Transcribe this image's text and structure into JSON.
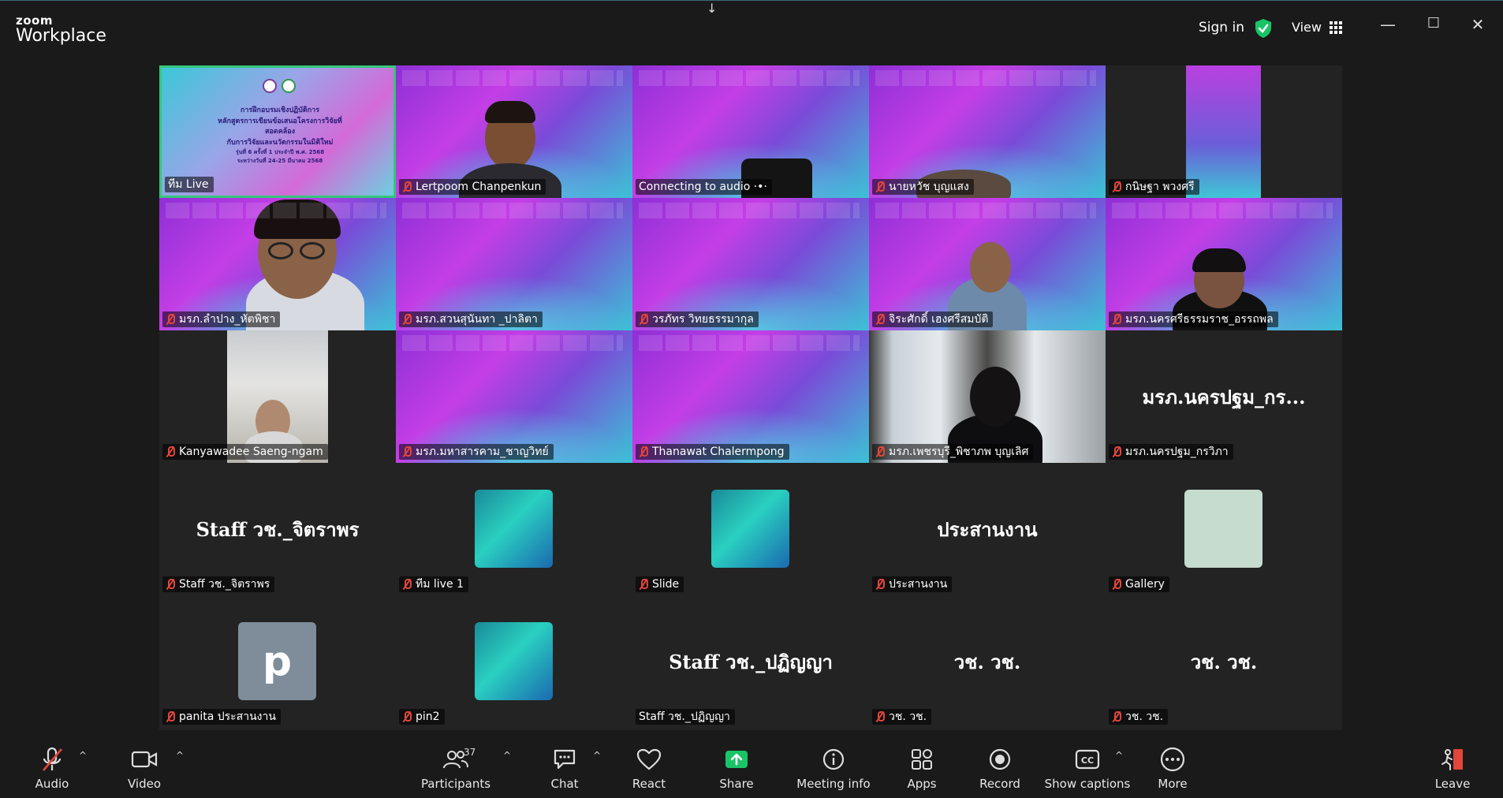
{
  "app": {
    "brand_top": "zoom",
    "brand_bottom": "Workplace"
  },
  "titlebar": {
    "sign_in": "Sign in",
    "view": "View",
    "minimize": "—",
    "maximize": "☐",
    "close": "✕",
    "down_arrow": "↓"
  },
  "poster": {
    "line1": "การฝึกอบรมเชิงปฏิบัติการ",
    "line2": "หลักสูตรการเขียนข้อเสนอโครงการวิจัยที่สอดคล้อง",
    "line3": "กับการวิจัยและนวัตกรรมในมิติใหม่",
    "line4": "รุ่นที่ 6 ครั้งที่ 1 ประจำปี พ.ศ. 2568",
    "line5": "ระหว่างวันที่ 24-25 มีนาคม 2568"
  },
  "tiles": [
    {
      "name": "ทีม Live",
      "muted": false
    },
    {
      "name": "Lertpoom Chanpenkun",
      "muted": true
    },
    {
      "name": "Connecting to audio ·•·",
      "muted": false
    },
    {
      "name": "นายหวัช บุญแสง",
      "muted": true
    },
    {
      "name": "กนิษฐา พวงศรี",
      "muted": true
    },
    {
      "name": "มรภ.ลำปาง_หัตพิชา",
      "muted": true
    },
    {
      "name": "มรภ.สวนสุนันทา _ปาลิตา",
      "muted": true
    },
    {
      "name": "วรภัทร วิทยธรรมากุล",
      "muted": true
    },
    {
      "name": "จิระศักดิ์ เฮงศรีสมบัติ",
      "muted": true
    },
    {
      "name": "มรภ.นครศรีธรรมราช_อรรถพล",
      "muted": true
    },
    {
      "name": "Kanyawadee Saeng-ngam",
      "muted": true
    },
    {
      "name": "มรภ.มหาสารคาม_ชาญวิทย์",
      "muted": true
    },
    {
      "name": "Thanawat Chalermpong",
      "muted": true
    },
    {
      "name": "มรภ.เพชรบุรี_พิชาภพ บุญเลิศ",
      "muted": true
    },
    {
      "name": "มรภ.นครปฐม_กรวิภา",
      "muted": true,
      "big": "มรภ.นครปฐม_กร..."
    },
    {
      "name": "Staff วช._จิตราพร",
      "muted": true,
      "big": "Staff วช._จิตราพร"
    },
    {
      "name": "ทีม live 1",
      "muted": true
    },
    {
      "name": "Slide",
      "muted": true
    },
    {
      "name": "ประสานงาน",
      "muted": true,
      "big": "ประสานงาน"
    },
    {
      "name": "Gallery",
      "muted": true
    },
    {
      "name": "panita ประสานงาน",
      "muted": true,
      "letter": "p"
    },
    {
      "name": "pin2",
      "muted": true
    },
    {
      "name": "Staff วช._ปฏิญญา",
      "muted": false,
      "big": "Staff วช._ปฏิญญา"
    },
    {
      "name": "วช. วช.",
      "muted": true,
      "big": "วช. วช."
    },
    {
      "name": "วช. วช.",
      "muted": true,
      "big": "วช. วช."
    }
  ],
  "toolbar": {
    "audio": "Audio",
    "video": "Video",
    "participants": "Participants",
    "participants_count": "37",
    "chat": "Chat",
    "react": "React",
    "share": "Share",
    "meeting_info": "Meeting info",
    "apps": "Apps",
    "record": "Record",
    "show_captions": "Show captions",
    "more": "More",
    "leave": "Leave"
  },
  "colors": {
    "active_speaker": "#34c77b",
    "muted": "#e0463c",
    "share": "#19c467",
    "leave": "#e0463c"
  }
}
